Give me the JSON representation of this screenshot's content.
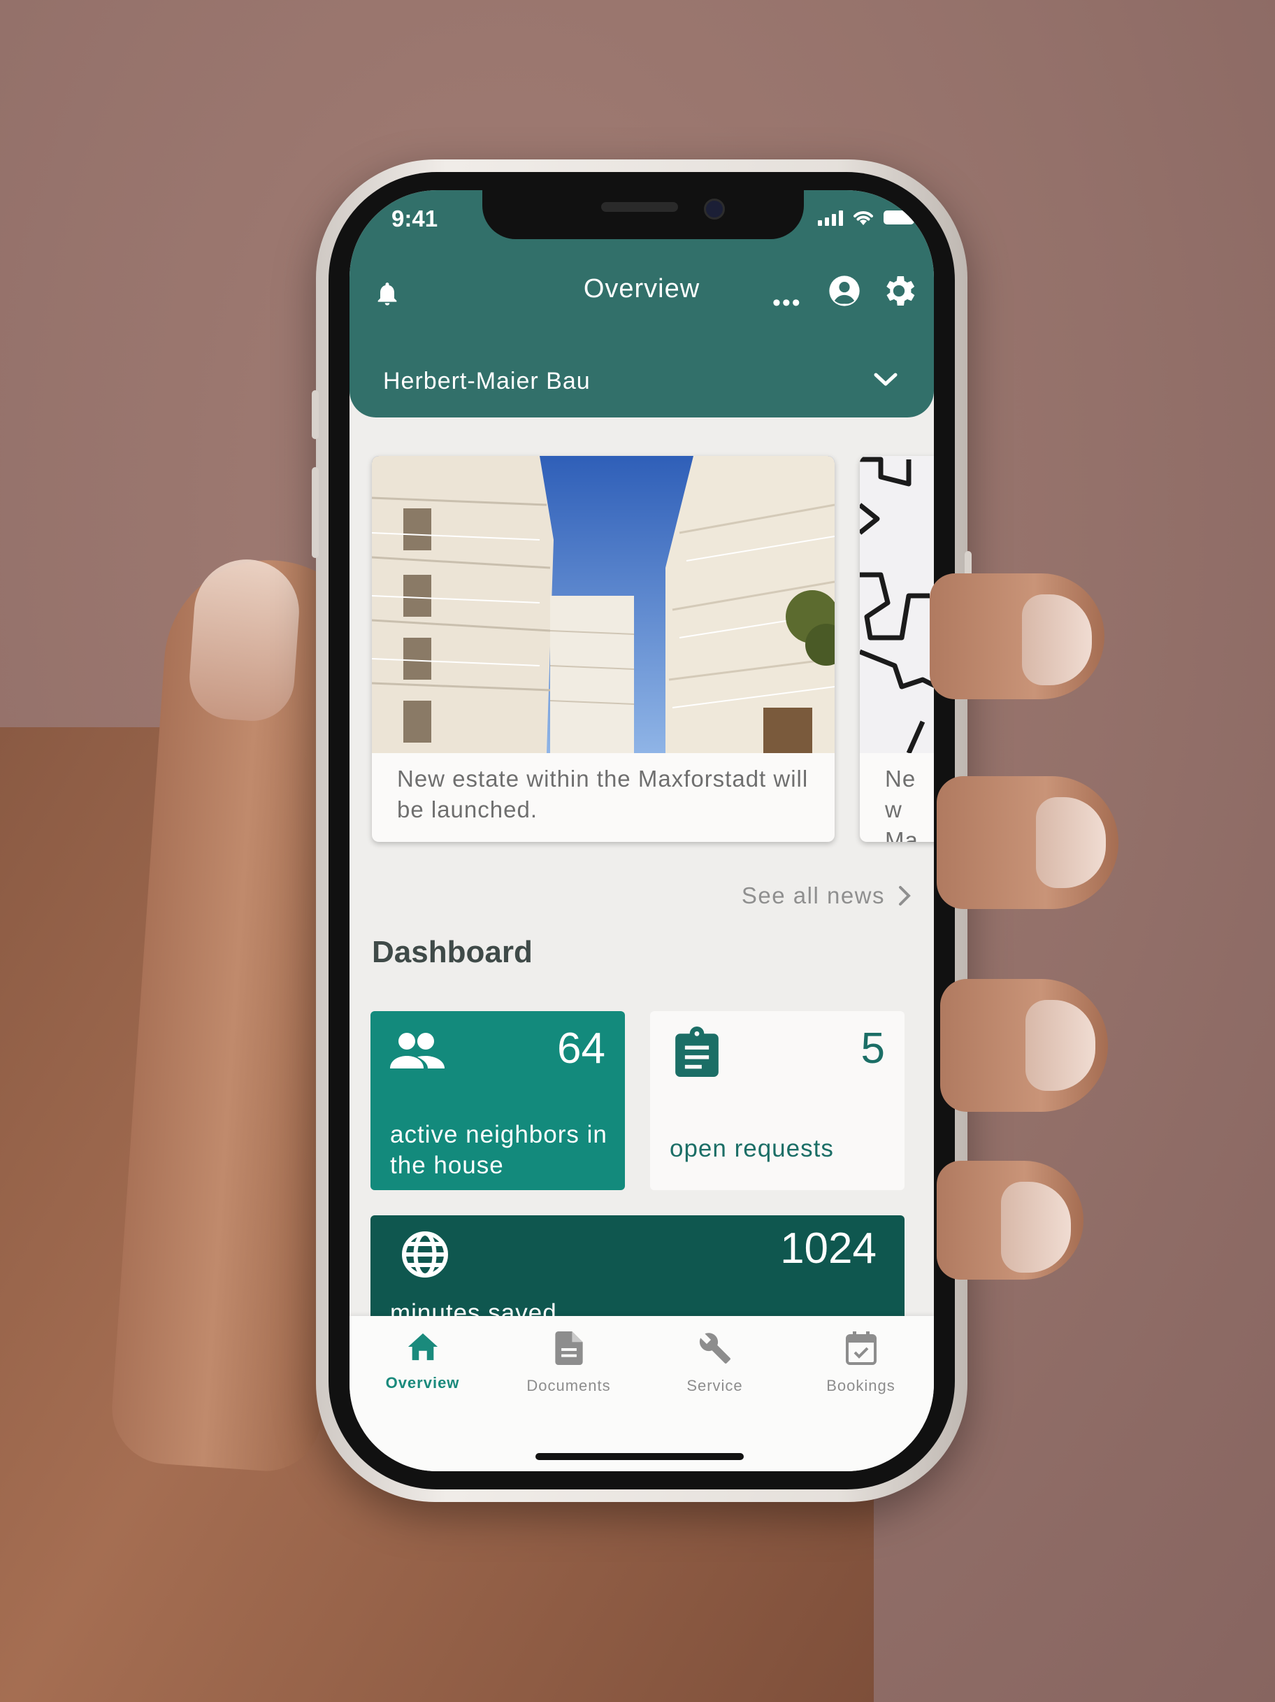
{
  "status_bar": {
    "time": "9:41"
  },
  "header": {
    "title": "Overview",
    "more_label": "•••",
    "property_selector": "Herbert-Maier Bau"
  },
  "news": {
    "items": [
      {
        "text": "New estate within the Maxforstadt will be launched."
      },
      {
        "text": "New Max"
      }
    ],
    "see_all": "See all news"
  },
  "dashboard": {
    "title": "Dashboard",
    "tiles": [
      {
        "value": "64",
        "label": "active neighbors in the house",
        "icon": "people-icon"
      },
      {
        "value": "5",
        "label": "open requests",
        "icon": "clipboard-icon"
      },
      {
        "value": "1024",
        "label": "minutes saved",
        "icon": "globe-icon"
      }
    ]
  },
  "bottom_nav": {
    "items": [
      {
        "label": "Overview",
        "icon": "home-icon",
        "active": true
      },
      {
        "label": "Documents",
        "icon": "document-icon"
      },
      {
        "label": "Service",
        "icon": "wrench-icon"
      },
      {
        "label": "Bookings",
        "icon": "calendar-check-icon"
      }
    ]
  },
  "colors": {
    "header": "#32706a",
    "accent": "#138a7c",
    "tile_dark": "#0f574f",
    "background": "#94716a"
  }
}
